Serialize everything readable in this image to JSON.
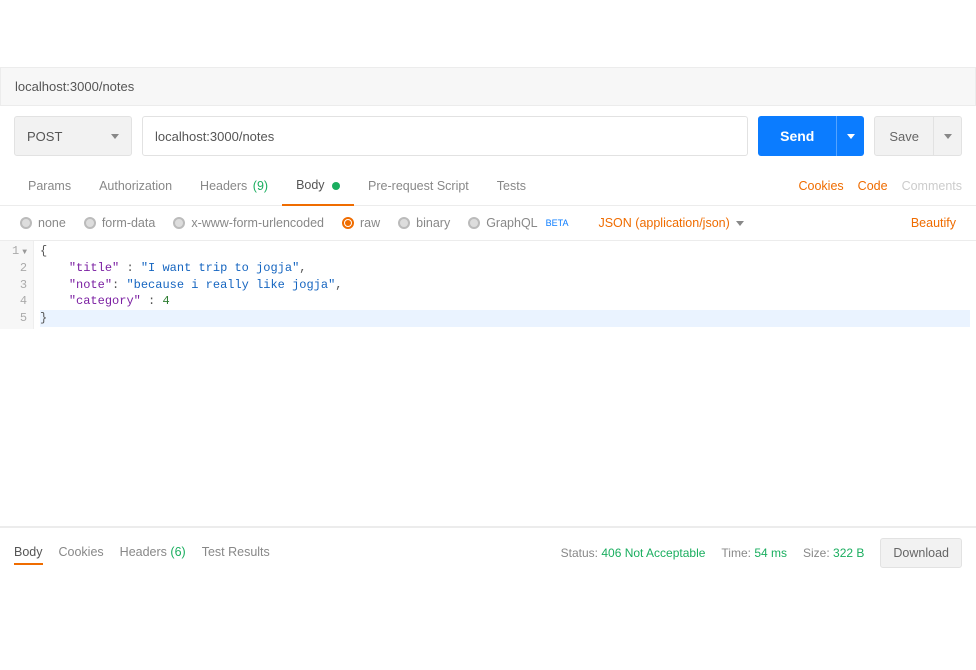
{
  "url_bar": "localhost:3000/notes",
  "request": {
    "method": "POST",
    "url": "localhost:3000/notes",
    "send": "Send",
    "save": "Save"
  },
  "tabs": {
    "params": "Params",
    "auth": "Authorization",
    "headers": "Headers",
    "headers_count": "(9)",
    "body": "Body",
    "prereq": "Pre-request Script",
    "tests": "Tests",
    "cookies": "Cookies",
    "code": "Code",
    "comments": "Comments"
  },
  "body_types": {
    "none": "none",
    "formdata": "form-data",
    "urlencoded": "x-www-form-urlencoded",
    "raw": "raw",
    "binary": "binary",
    "graphql": "GraphQL",
    "beta": "BETA",
    "content_type": "JSON (application/json)",
    "beautify": "Beautify"
  },
  "editor": {
    "lines": [
      "1",
      "2",
      "3",
      "4",
      "5"
    ],
    "l1_open": "{",
    "l2_k": "\"title\"",
    "l2_s": "\"I want trip to jogja\"",
    "l3_k": "\"note\"",
    "l3_s": "\"because i really like jogja\"",
    "l4_k": "\"category\"",
    "l4_n": "4",
    "l5_close": "}"
  },
  "response": {
    "body": "Body",
    "cookies": "Cookies",
    "headers": "Headers",
    "headers_count": "(6)",
    "test_results": "Test Results",
    "status_label": "Status:",
    "status_value": "406 Not Acceptable",
    "time_label": "Time:",
    "time_value": "54 ms",
    "size_label": "Size:",
    "size_value": "322 B",
    "download": "Download"
  }
}
